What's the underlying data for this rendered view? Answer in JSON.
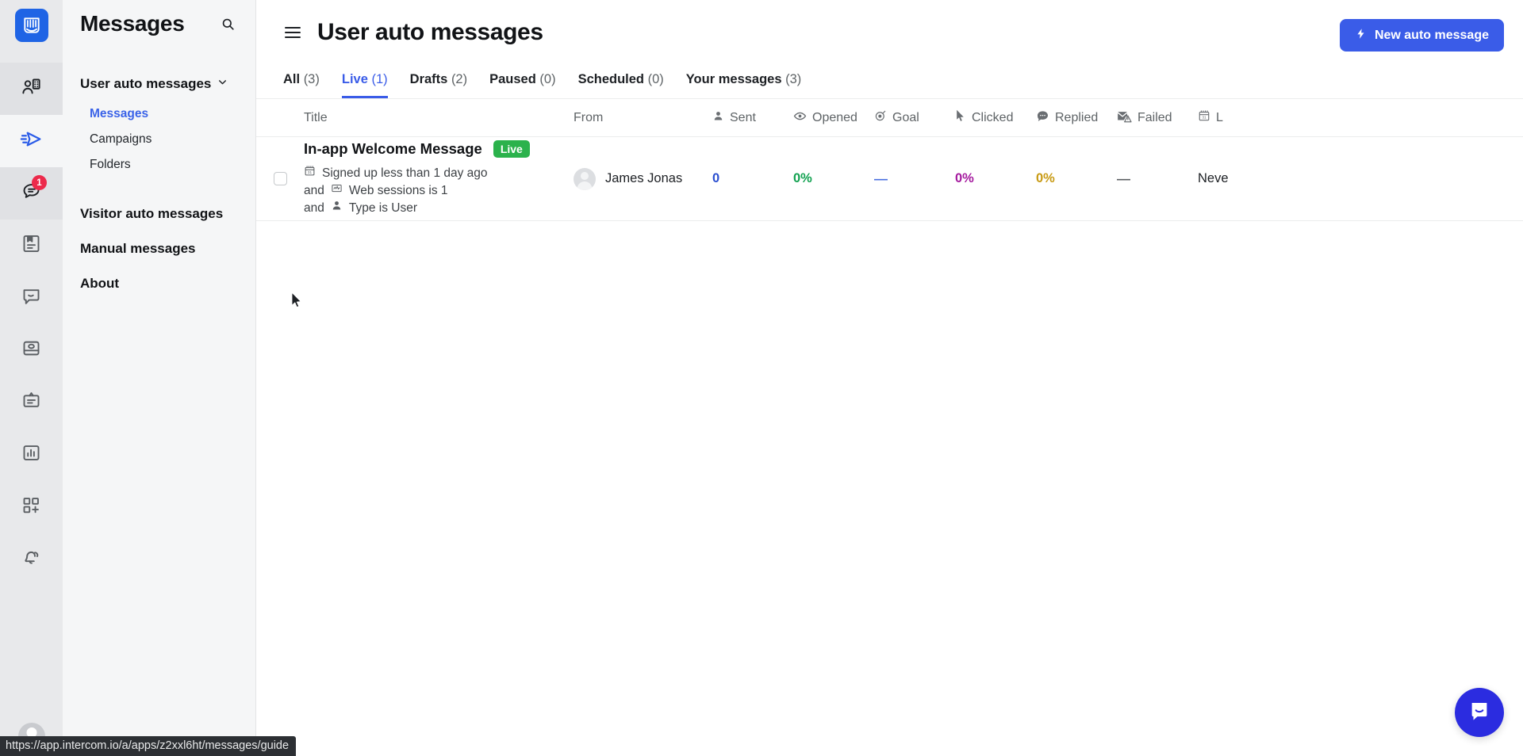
{
  "rail": {
    "logo_icon": "intercom-logo-icon",
    "items": [
      {
        "name": "contacts-icon",
        "state": "shaded"
      },
      {
        "name": "send-outbound-icon",
        "state": "active"
      },
      {
        "name": "inbox-conversations-icon",
        "state": "shaded",
        "badge": "1"
      },
      {
        "name": "articles-icon",
        "state": "normal"
      },
      {
        "name": "messenger-icon",
        "state": "normal"
      },
      {
        "name": "product-tours-icon",
        "state": "normal"
      },
      {
        "name": "surveys-icon",
        "state": "normal"
      },
      {
        "name": "reports-chart-icon",
        "state": "normal"
      },
      {
        "name": "apps-add-icon",
        "state": "normal"
      },
      {
        "name": "notifications-bell-icon",
        "state": "normal"
      }
    ]
  },
  "sidebar": {
    "title": "Messages",
    "search_icon": "search-icon",
    "group": {
      "label": "User auto messages",
      "chevron": "chevron-down-icon",
      "items": [
        {
          "label": "Messages",
          "current": true
        },
        {
          "label": "Campaigns",
          "current": false
        },
        {
          "label": "Folders",
          "current": false
        }
      ]
    },
    "items": [
      {
        "label": "Visitor auto messages"
      },
      {
        "label": "Manual messages"
      },
      {
        "label": "About"
      }
    ]
  },
  "header": {
    "menu_icon": "hamburger-menu-icon",
    "title": "User auto messages",
    "new_button": {
      "label": "New auto message",
      "icon": "lightning-bolt-icon"
    }
  },
  "tabs": [
    {
      "label": "All",
      "count": "(3)",
      "active": false
    },
    {
      "label": "Live",
      "count": "(1)",
      "active": true
    },
    {
      "label": "Drafts",
      "count": "(2)",
      "active": false
    },
    {
      "label": "Paused",
      "count": "(0)",
      "active": false
    },
    {
      "label": "Scheduled",
      "count": "(0)",
      "active": false
    },
    {
      "label": "Your messages",
      "count": "(3)",
      "active": false
    }
  ],
  "table": {
    "columns": [
      {
        "label": "Title",
        "icon": null
      },
      {
        "label": "From",
        "icon": null
      },
      {
        "label": "Sent",
        "icon": "person-icon"
      },
      {
        "label": "Opened",
        "icon": "eye-icon"
      },
      {
        "label": "Goal",
        "icon": "target-icon"
      },
      {
        "label": "Clicked",
        "icon": "cursor-arrow-icon"
      },
      {
        "label": "Replied",
        "icon": "chat-bubble-icon"
      },
      {
        "label": "Failed",
        "icon": "failed-mail-icon"
      },
      {
        "label": "L",
        "icon": "calendar-icon"
      }
    ],
    "rows": [
      {
        "checked": false,
        "title": "In-app Welcome Message",
        "status_badge": "Live",
        "rules": [
          {
            "prefix": "",
            "icon": "calendar-icon",
            "text": "Signed up less than 1 day ago"
          },
          {
            "prefix": "and",
            "icon": "web-sessions-icon",
            "text": "Web sessions is 1"
          },
          {
            "prefix": "and",
            "icon": "person-icon",
            "text": "Type is User"
          }
        ],
        "from": "James Jonas",
        "sent": "0",
        "opened": "0%",
        "goal": "—",
        "clicked": "0%",
        "replied": "0%",
        "failed": "—",
        "last": "Neve"
      }
    ]
  },
  "launcher": {
    "icon": "intercom-messenger-icon"
  },
  "statusbar": {
    "url": "https://app.intercom.io/a/apps/z2xxl6ht/messages/guide"
  },
  "colors": {
    "brand_blue": "#3a5ce8",
    "logo_blue": "#1f64e5",
    "live_green": "#2bb24c",
    "sent_blue": "#2b4fd0",
    "opened_green": "#12a150",
    "clicked_purple": "#a4199e",
    "replied_gold": "#c89a13",
    "badge_red": "#ec2a4b",
    "launcher_blue": "#2b2ce0"
  }
}
